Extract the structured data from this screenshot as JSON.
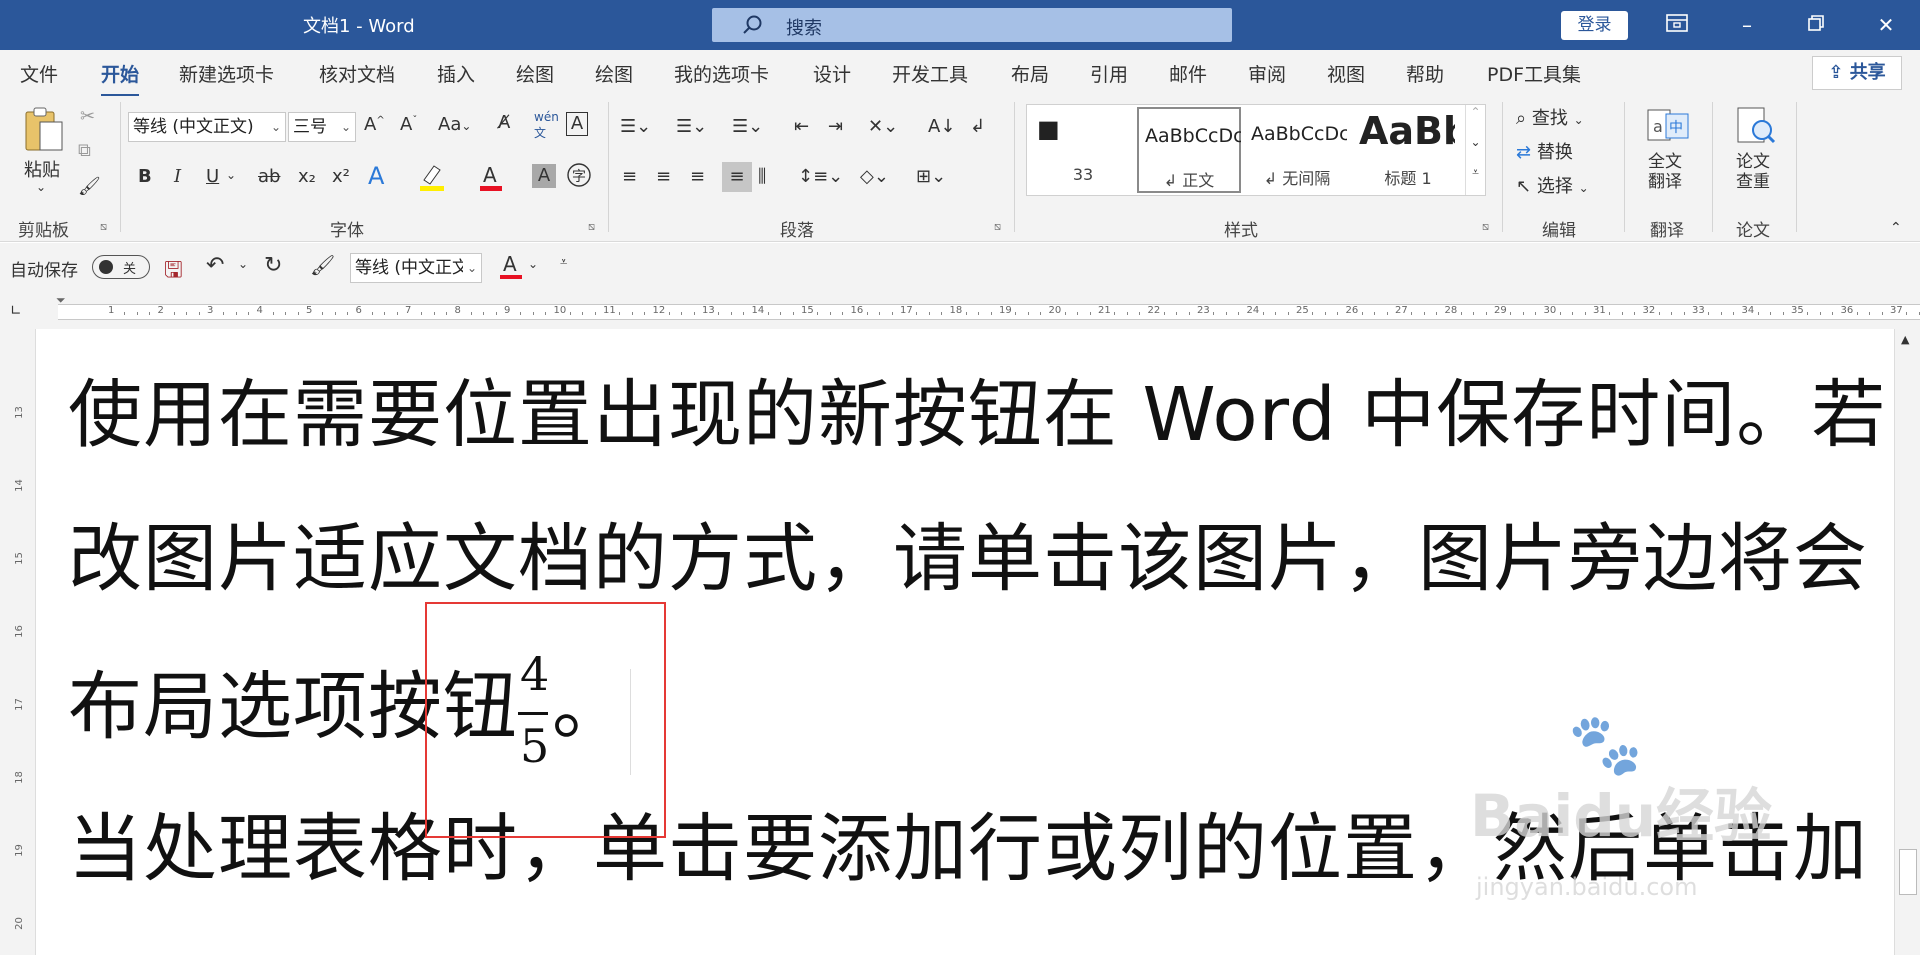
{
  "titlebar": {
    "title": "文档1  -  Word",
    "search_placeholder": "搜索",
    "login_label": "登录",
    "ribbon_display_icon": "ribbon-display-icon",
    "minimize_icon": "minimize-icon",
    "restore_icon": "restore-icon",
    "close_icon": "close-icon"
  },
  "menu": {
    "tabs": [
      "文件",
      "开始",
      "新建选项卡",
      "核对文档",
      "插入",
      "绘图",
      "绘图",
      "我的选项卡",
      "设计",
      "开发工具",
      "布局",
      "引用",
      "邮件",
      "审阅",
      "视图",
      "帮助",
      "PDF工具集"
    ],
    "active": "开始",
    "share_label": "共享"
  },
  "ribbon": {
    "clipboard": {
      "paste_label": "粘贴",
      "group_label": "剪贴板"
    },
    "font": {
      "font_name": "等线 (中文正文)",
      "font_size": "三号",
      "bold": "B",
      "italic": "I",
      "underline": "U",
      "strikethrough": "ab",
      "subscript": "x₂",
      "superscript": "x²",
      "aa_label": "Aa",
      "group_label": "字体"
    },
    "paragraph": {
      "group_label": "段落"
    },
    "styles": {
      "items": [
        {
          "preview": "■",
          "name": "33"
        },
        {
          "preview": "AaBbCcDc",
          "name": "↲ 正文"
        },
        {
          "preview": "AaBbCcDc",
          "name": "↲ 无间隔"
        },
        {
          "preview": "AaBb",
          "name": "标题 1"
        }
      ],
      "group_label": "样式"
    },
    "editing": {
      "find": "查找",
      "replace": "替换",
      "select": "选择",
      "group_label": "编辑"
    },
    "translate": {
      "button_label": "全文\n翻译",
      "group_label": "翻译"
    },
    "paper": {
      "button_label": "论文\n查重",
      "group_label": "论文"
    }
  },
  "qat": {
    "autosave_label": "自动保存",
    "autosave_state": "关",
    "font_name": "等线 (中文正文)"
  },
  "ruler": {
    "numbers": [
      "1",
      "2",
      "3",
      "4",
      "5",
      "6",
      "7",
      "8",
      "9",
      "10",
      "11",
      "12",
      "13",
      "14",
      "15",
      "16",
      "17",
      "18",
      "19",
      "20",
      "21",
      "22",
      "23",
      "24",
      "25",
      "26",
      "27",
      "28",
      "29",
      "30",
      "31",
      "32",
      "33",
      "34",
      "35",
      "36",
      "37"
    ]
  },
  "vruler": {
    "numbers": [
      "13",
      "14",
      "15",
      "16",
      "17",
      "18",
      "19",
      "20"
    ]
  },
  "document": {
    "line1": "使用在需要位置出现的新按钮在  Word  中保存时间。若",
    "line2": "改图片适应文档的方式，请单击该图片，图片旁边将会",
    "line3_text": "布局选项按钮",
    "fraction_numerator": "4",
    "fraction_denominator": "5",
    "line3_end": "。",
    "line4": "当处理表格时，单击要添加行或列的位置，然后单击加"
  },
  "watermark": {
    "brand": "Baidu经验",
    "url": "jingyan.baidu.com"
  },
  "colors": {
    "title_bar": "#2b579a",
    "highlight_box": "#e53935",
    "font_color_bar": "#e81123",
    "highlight_color_bar": "#ffee00"
  }
}
